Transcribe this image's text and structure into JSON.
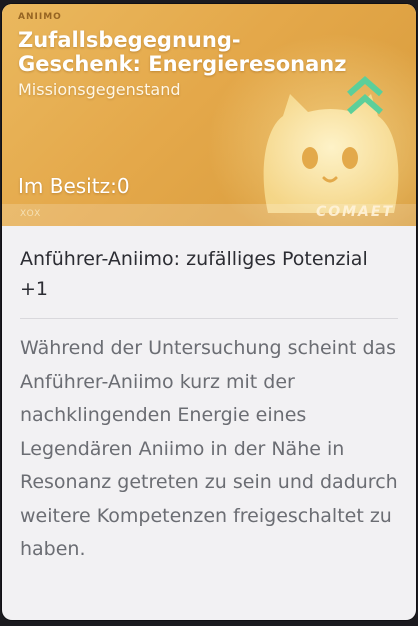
{
  "item": {
    "brand_label": "ANIIMO",
    "title": "Zufallsbegegnung-Geschenk: Energieresonanz",
    "type": "Missionsgegenstand",
    "owned_label": "Im Besitz:",
    "owned_count": "0",
    "code": "XOX",
    "footer_brand": "COMAET"
  },
  "effect": "Anführer-Aniimo: zufälliges Potenzial +1",
  "description": "Während der Untersuchung scheint das Anführer-Aniimo kurz mit der nachklingenden Energie eines Legendären Aniimo in der Nähe in Resonanz getreten zu sein und dadurch weitere Kompetenzen freigeschaltet zu haben.",
  "colors": {
    "header_gold": "#e4a84a",
    "rank_green": "#5ccf9a",
    "body_bg": "#f2f1f3",
    "effect_text": "#2c2d33",
    "desc_text": "#6b6d73"
  },
  "icons": {
    "rank": "double-chevron-up-icon",
    "art": "aniimo-creature-icon"
  }
}
